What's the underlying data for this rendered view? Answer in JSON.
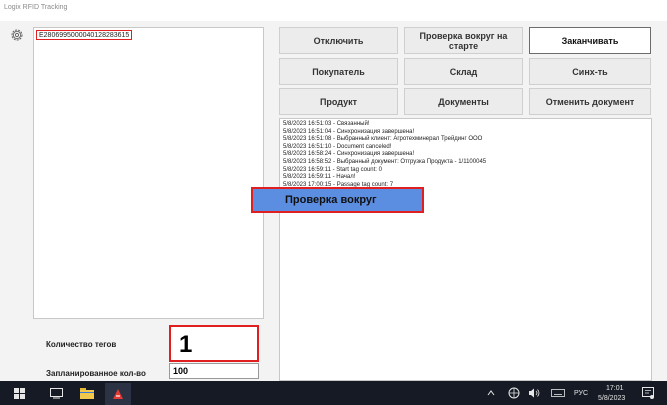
{
  "window": {
    "title": "Logix RFID Tracking"
  },
  "tag_list": {
    "items": [
      "E2806995000040128283615"
    ]
  },
  "buttons": {
    "disconnect": "Отключить",
    "check_start": "Проверка вокруг на старте",
    "finish": "Заканчивать",
    "buyer": "Покупатель",
    "warehouse": "Склад",
    "sync": "Синх-ть",
    "product": "Продукт",
    "documents": "Документы",
    "cancel_doc": "Отменить документ"
  },
  "log_lines": [
    "5/8/2023 16:51:03 - Связанный!",
    "5/8/2023 16:51:04 - Синхронизация завершена!",
    "5/8/2023 16:51:08 - Выбранный клиент: Агротехминерал Трейдинг ООО",
    "5/8/2023 16:51:10 - Document canceled!",
    "5/8/2023 16:58:24 - Синхронизация завершена!",
    "5/8/2023 16:58:52 - Выбранный документ: Отгрузка Продукта - 1/1100045",
    "5/8/2023 16:59:11 - Start tag count: 0",
    "5/8/2023 16:59:11 - Начал!",
    "5/8/2023 17:00:15 - Passage tag count: 7"
  ],
  "overlay": {
    "check_around_label": "Проверка вокруг"
  },
  "counts": {
    "tag_count_label": "Количество тегов",
    "tag_count_value": "1",
    "planned_label": "Запланированное кол-во",
    "planned_value": "100"
  },
  "taskbar": {
    "lang": "РУС",
    "time": "17:01",
    "date": "5/8/2023"
  },
  "colors": {
    "highlight": "#e02020",
    "overlay_button": "#5b8de0",
    "taskbar": "#151a24"
  }
}
